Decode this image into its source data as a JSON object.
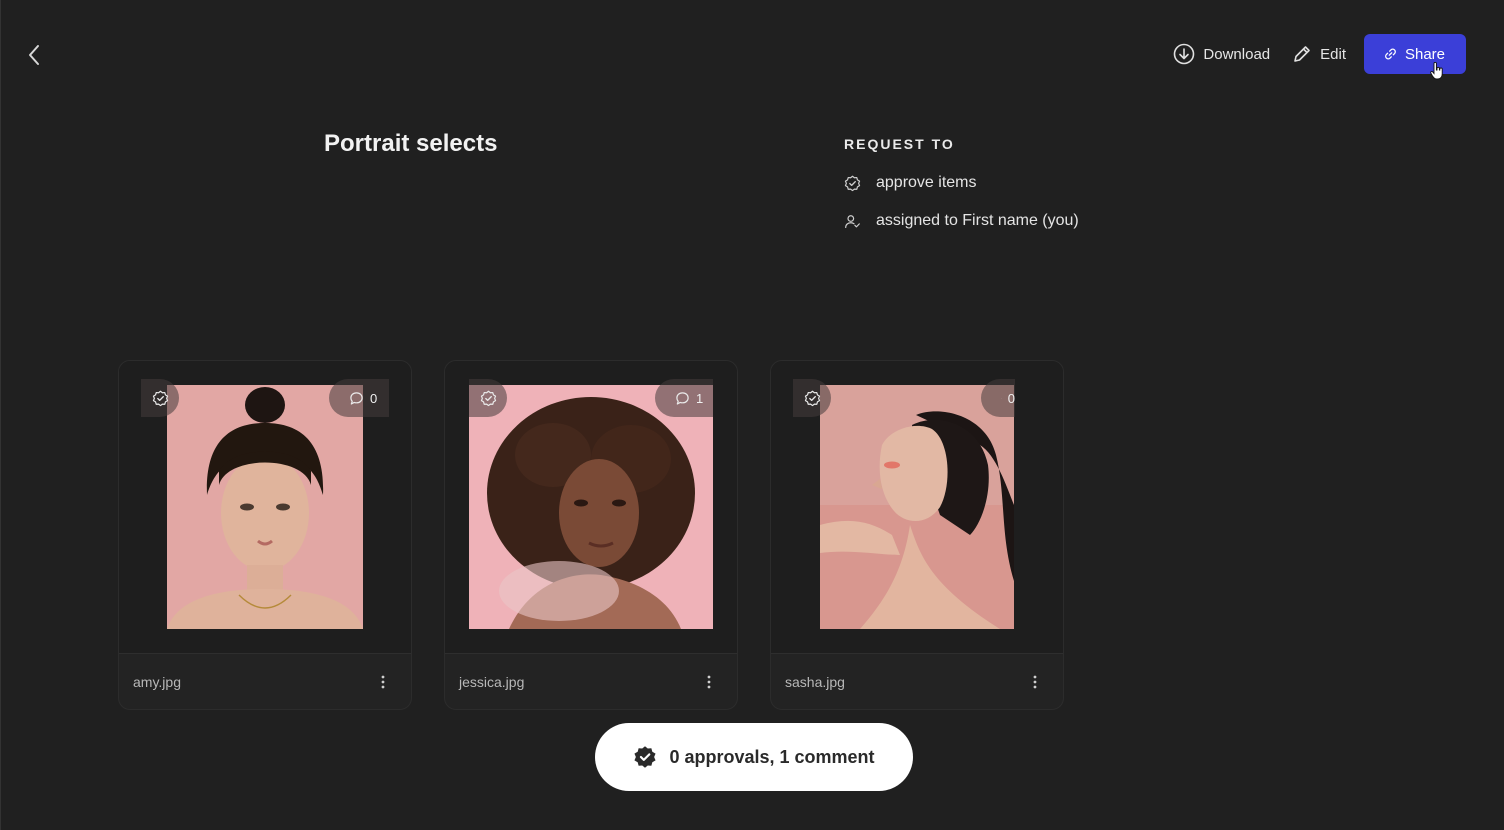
{
  "toolbar": {
    "download_label": "Download",
    "edit_label": "Edit",
    "share_label": "Share",
    "share_color": "#3b3fd8"
  },
  "page": {
    "title": "Portrait selects"
  },
  "request": {
    "heading": "REQUEST TO",
    "items": [
      {
        "icon": "approve-badge-icon",
        "label": "approve items"
      },
      {
        "icon": "assigned-user-icon",
        "label": "assigned to First name (you)"
      }
    ]
  },
  "cards": [
    {
      "filename": "amy.jpg",
      "comments": "0",
      "photo_bg": "#e5a9a6"
    },
    {
      "filename": "jessica.jpg",
      "comments": "1",
      "photo_bg": "#eeb0b6"
    },
    {
      "filename": "sasha.jpg",
      "comments": "0",
      "photo_bg": "#d99992"
    }
  ],
  "summary": {
    "label": "0 approvals, 1 comment"
  }
}
